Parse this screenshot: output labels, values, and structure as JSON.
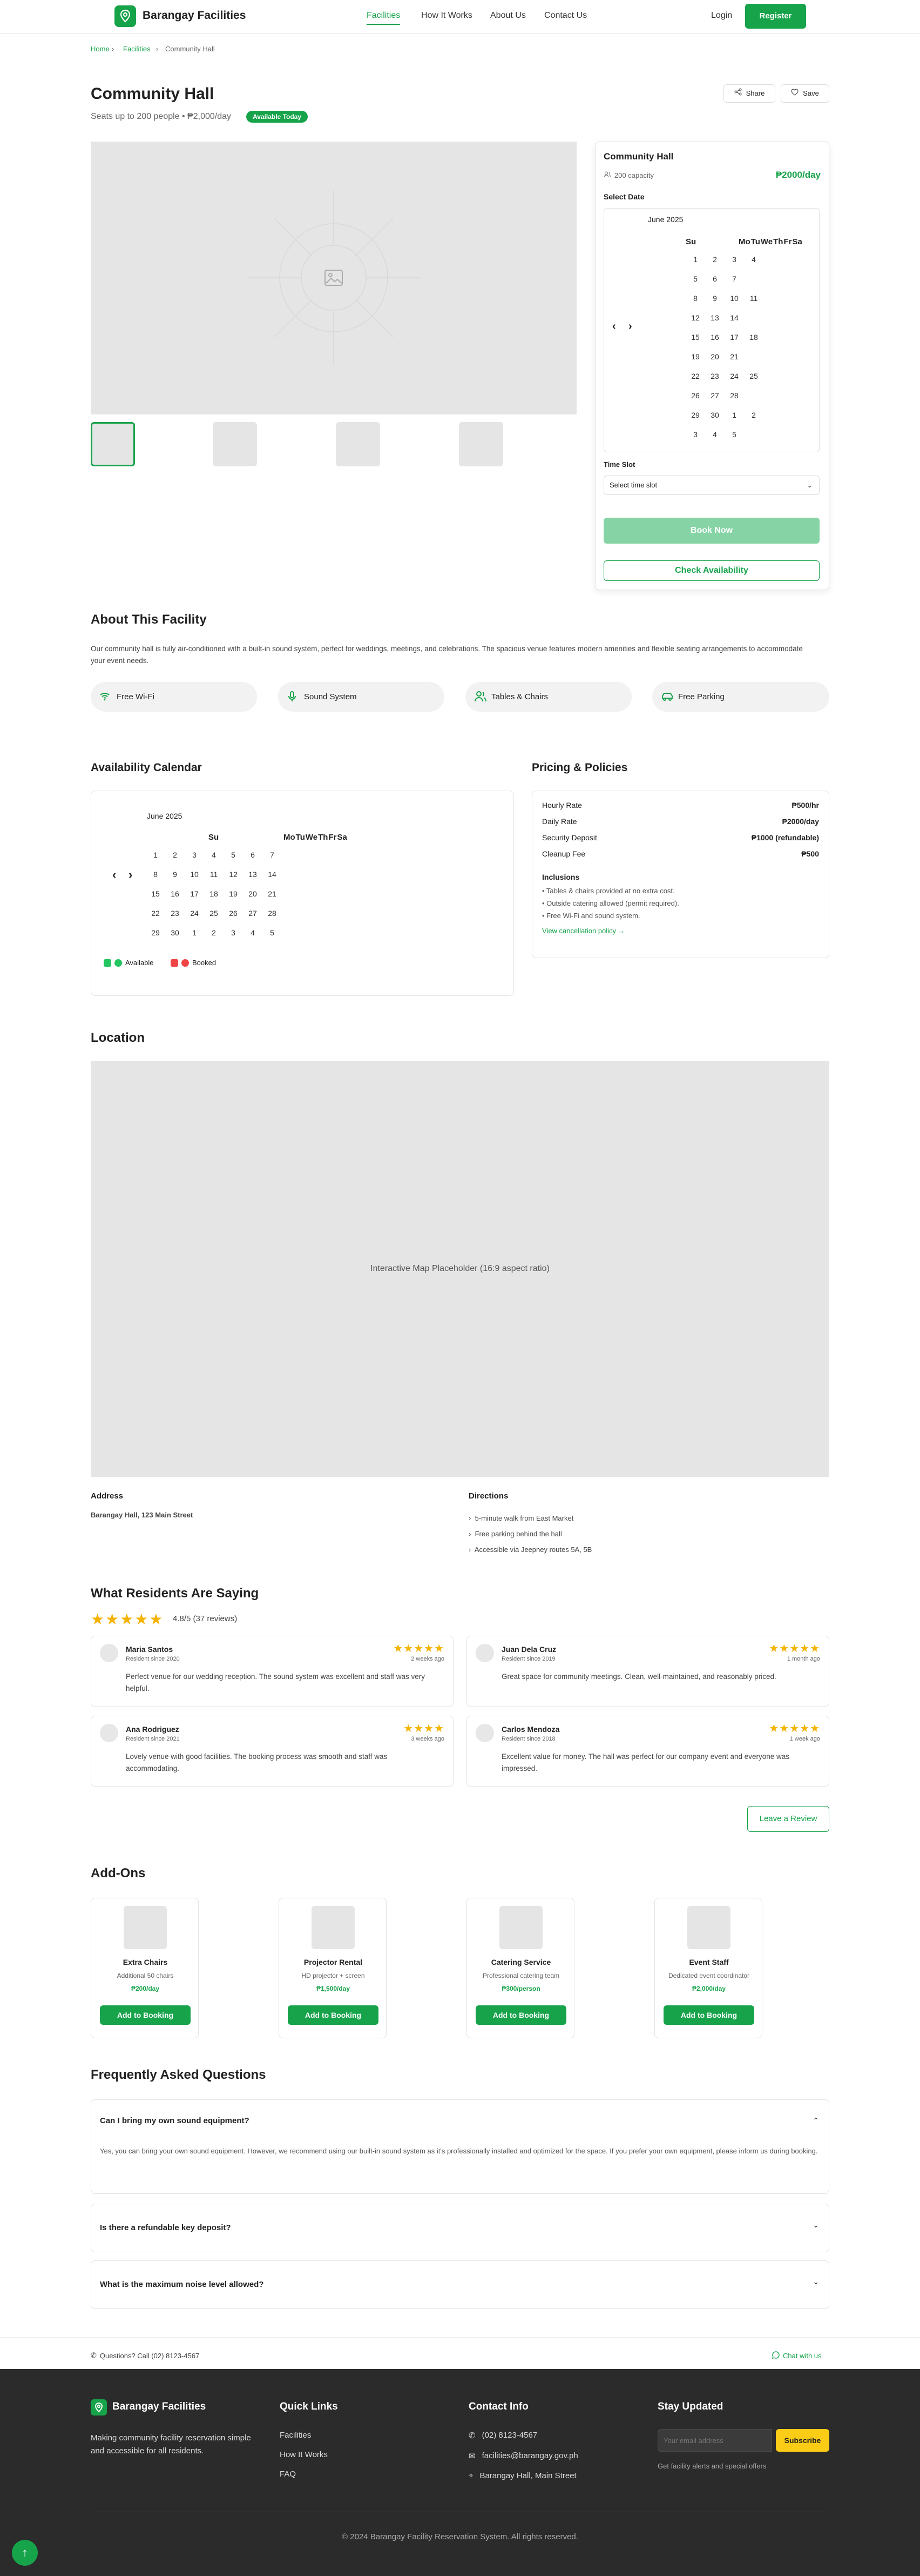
{
  "header": {
    "brand": "Barangay Facilities",
    "nav": [
      "Facilities",
      "How It Works",
      "About Us",
      "Contact Us"
    ],
    "login": "Login",
    "register": "Register"
  },
  "breadcrumb": [
    "Home",
    "Facilities",
    "Community Hall"
  ],
  "facility": {
    "title": "Community Hall",
    "subtitle": "Seats up to 200 people • ₱2,000/day",
    "badge": "Available Today",
    "share": "Share",
    "save": "Save"
  },
  "booking": {
    "title": "Community Hall",
    "capacity": "200 capacity",
    "price": "₱2000/day",
    "select_date": "Select Date",
    "month": "June 2025",
    "time_slot_label": "Time Slot",
    "time_slot_value": "Select time slot",
    "book_now": "Book Now",
    "check": "Check Availability"
  },
  "calendar_headers": [
    "Su",
    "Mo",
    "Tu",
    "We",
    "Th",
    "Fr",
    "Sa"
  ],
  "side_cal_rows": [
    [
      "",
      "",
      "1",
      "2",
      "3",
      "4",
      ""
    ],
    [
      "",
      "",
      "5",
      "6",
      "7",
      "",
      ""
    ],
    [
      "",
      "",
      "8",
      "9",
      "10",
      "11",
      ""
    ],
    [
      "",
      "",
      "12",
      "13",
      "14",
      "",
      ""
    ],
    [
      "",
      "",
      "15",
      "16",
      "17",
      "18",
      ""
    ],
    [
      "",
      "",
      "19",
      "20",
      "21",
      "",
      ""
    ],
    [
      "",
      "",
      "22",
      "23",
      "24",
      "25",
      ""
    ],
    [
      "",
      "",
      "26",
      "27",
      "28",
      "",
      ""
    ],
    [
      "",
      "",
      "29",
      "30",
      "1",
      "2",
      ""
    ],
    [
      "",
      "",
      "3",
      "4",
      "5",
      "",
      ""
    ]
  ],
  "about": {
    "title": "About This Facility",
    "text": "Our community hall is fully air-conditioned with a built-in sound system, perfect for weddings, meetings, and celebrations. The spacious venue features modern amenities and flexible seating arrangements to accommodate your event needs.",
    "amenities": [
      "Free Wi-Fi",
      "Sound System",
      "Tables & Chairs",
      "Free Parking"
    ]
  },
  "availability": {
    "title": "Availability Calendar",
    "month": "June 2025",
    "rows": [
      [
        "1",
        "2",
        "3",
        "4",
        "5",
        "6",
        "7"
      ],
      [
        "8",
        "9",
        "10",
        "11",
        "12",
        "13",
        "14"
      ],
      [
        "15",
        "16",
        "17",
        "18",
        "19",
        "20",
        "21"
      ],
      [
        "22",
        "23",
        "24",
        "25",
        "26",
        "27",
        "28"
      ],
      [
        "29",
        "30",
        "1",
        "2",
        "3",
        "4",
        "5"
      ]
    ],
    "available": "Available",
    "booked": "Booked"
  },
  "pricing": {
    "title": "Pricing & Policies",
    "rows": [
      [
        "Hourly Rate",
        "₱500/hr"
      ],
      [
        "Daily Rate",
        "₱2000/day"
      ],
      [
        "Security Deposit",
        "₱1000 (refundable)"
      ],
      [
        "Cleanup Fee",
        "₱500"
      ]
    ],
    "inclusions_title": "Inclusions",
    "inclusions": [
      "• Tables & chairs provided at no extra cost.",
      "• Outside catering allowed (permit required).",
      "• Free Wi-Fi and sound system."
    ],
    "policy_link": "View cancellation policy →"
  },
  "location": {
    "title": "Location",
    "map": "Interactive Map Placeholder (16:9 aspect ratio)",
    "address_title": "Address",
    "address": "Barangay Hall, 123 Main Street",
    "directions_title": "Directions",
    "directions": [
      "5-minute walk from East Market",
      "Free parking behind the hall",
      "Accessible via Jeepney routes 5A, 5B"
    ]
  },
  "reviews": {
    "title": "What Residents Are Saying",
    "summary": "4.8/5 (37 reviews)",
    "leave": "Leave a Review",
    "items": [
      {
        "name": "Maria Santos",
        "since": "Resident since 2020",
        "time": "2 weeks ago",
        "stars": "★★★★★",
        "text": "Perfect venue for our wedding reception. The sound system was excellent and staff was very helpful."
      },
      {
        "name": "Juan Dela Cruz",
        "since": "Resident since 2019",
        "time": "1 month ago",
        "stars": "★★★★★",
        "text": "Great space for community meetings. Clean, well-maintained, and reasonably priced."
      },
      {
        "name": "Ana Rodriguez",
        "since": "Resident since 2021",
        "time": "3 weeks ago",
        "stars": "★★★★",
        "text": "Lovely venue with good facilities. The booking process was smooth and staff was accommodating."
      },
      {
        "name": "Carlos Mendoza",
        "since": "Resident since 2018",
        "time": "1 week ago",
        "stars": "★★★★★",
        "text": "Excellent value for money. The hall was perfect for our company event and everyone was impressed."
      }
    ]
  },
  "addons": {
    "title": "Add-Ons",
    "button": "Add to Booking",
    "items": [
      {
        "name": "Extra Chairs",
        "desc": "Additional 50 chairs",
        "price": "₱200/day"
      },
      {
        "name": "Projector Rental",
        "desc": "HD projector + screen",
        "price": "₱1,500/day"
      },
      {
        "name": "Catering Service",
        "desc": "Professional catering team",
        "price": "₱300/person"
      },
      {
        "name": "Event Staff",
        "desc": "Dedicated event coordinator",
        "price": "₱2,000/day"
      }
    ]
  },
  "faq": {
    "title": "Frequently Asked Questions",
    "items": [
      {
        "q": "Can I bring my own sound equipment?",
        "a": "Yes, you can bring your own sound equipment. However, we recommend using our built-in sound system as it's professionally installed and optimized for the space. If you prefer your own equipment, please inform us during booking."
      },
      {
        "q": "Is there a refundable key deposit?"
      },
      {
        "q": "What is the maximum noise level allowed?"
      }
    ]
  },
  "contact_bar": {
    "questions": "Questions? Call (02) 8123-4567",
    "chat": "Chat with us"
  },
  "footer": {
    "brand": "Barangay Facilities",
    "tagline": "Making community facility reservation simple and accessible for all residents.",
    "quick_title": "Quick Links",
    "quick": [
      "Facilities",
      "How It Works",
      "FAQ"
    ],
    "contact_title": "Contact Info",
    "phone": "(02) 8123-4567",
    "email": "facilities@barangay.gov.ph",
    "address": "Barangay Hall, Main Street",
    "stay_title": "Stay Updated",
    "email_placeholder": "Your email address",
    "subscribe": "Subscribe",
    "note": "Get facility alerts and special offers",
    "copyright": "© 2024 Barangay Facility Reservation System. All rights reserved."
  },
  "colors": {
    "accent": "#16a34a",
    "footer_bg": "#2b2b2b",
    "star": "#f5b301"
  }
}
